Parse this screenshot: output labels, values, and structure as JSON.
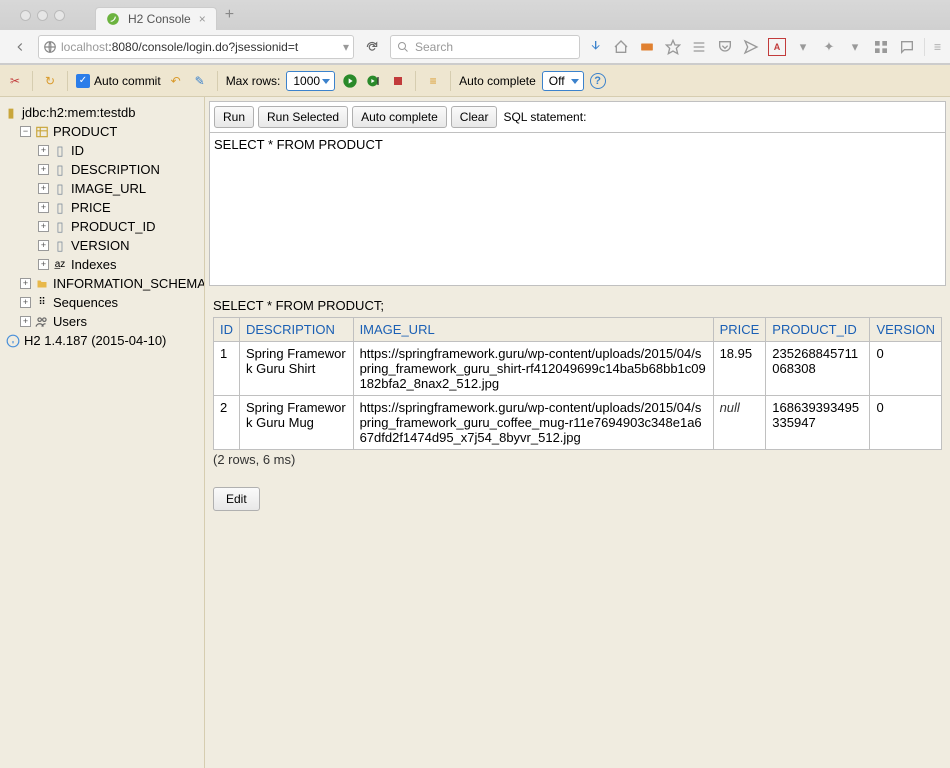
{
  "browser": {
    "tab_title": "H2 Console",
    "url_host": "localhost",
    "url_port_path": ":8080/console/login.do?jsessionid=t",
    "search_placeholder": "Search"
  },
  "h2_toolbar": {
    "auto_commit_label": "Auto commit",
    "max_rows_label": "Max rows:",
    "max_rows_value": "1000",
    "auto_complete_label": "Auto complete",
    "auto_complete_value": "Off"
  },
  "sidebar": {
    "db_url": "jdbc:h2:mem:testdb",
    "table_name": "PRODUCT",
    "columns": [
      "ID",
      "DESCRIPTION",
      "IMAGE_URL",
      "PRICE",
      "PRODUCT_ID",
      "VERSION"
    ],
    "indexes_label": "Indexes",
    "info_schema": "INFORMATION_SCHEMA",
    "sequences": "Sequences",
    "users": "Users",
    "version": "H2 1.4.187 (2015-04-10)"
  },
  "sql_panel": {
    "run": "Run",
    "run_selected": "Run Selected",
    "auto_complete": "Auto complete",
    "clear": "Clear",
    "statement_label": "SQL statement:",
    "statement": "SELECT * FROM PRODUCT"
  },
  "results": {
    "query": "SELECT * FROM PRODUCT;",
    "columns": [
      "ID",
      "DESCRIPTION",
      "IMAGE_URL",
      "PRICE",
      "PRODUCT_ID",
      "VERSION"
    ],
    "rows": [
      {
        "id": "1",
        "description": "Spring Framework Guru Shirt",
        "image_url": "https://springframework.guru/wp-content/uploads/2015/04/spring_framework_guru_shirt-rf412049699c14ba5b68bb1c09182bfa2_8nax2_512.jpg",
        "price": "18.95",
        "product_id": "235268845711068308",
        "version": "0"
      },
      {
        "id": "2",
        "description": "Spring Framework Guru Mug",
        "image_url": "https://springframework.guru/wp-content/uploads/2015/04/spring_framework_guru_coffee_mug-r11e7694903c348e1a667dfd2f1474d95_x7j54_8byvr_512.jpg",
        "price": "null",
        "product_id": "168639393495335947",
        "version": "0"
      }
    ],
    "footer": "(2 rows, 6 ms)",
    "edit": "Edit"
  }
}
